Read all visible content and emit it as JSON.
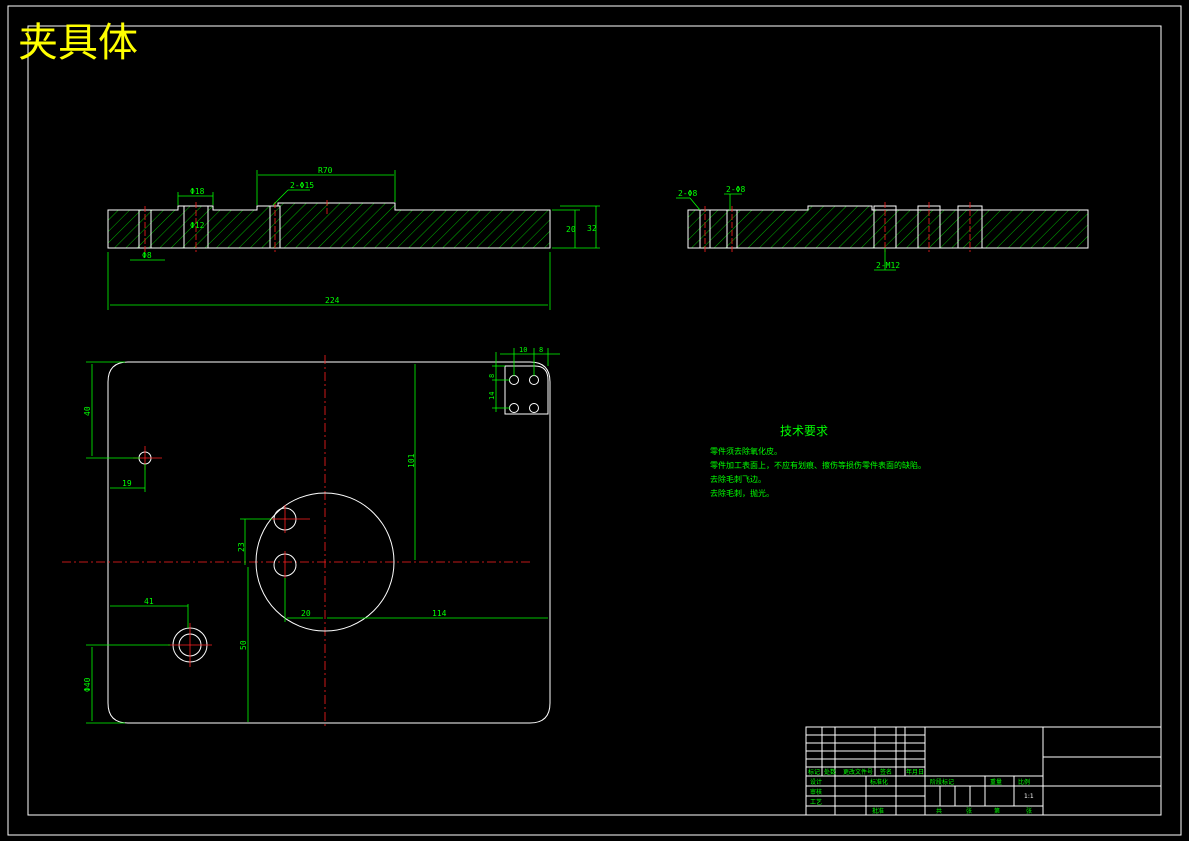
{
  "title": "夹具体",
  "colors": {
    "background": "#000000",
    "outline": "#ffffff",
    "dimension": "#00ff00",
    "centerline": "#ff2020",
    "title": "#ffff00"
  },
  "section_a_dims": {
    "width_total": "224",
    "top_step": "R70",
    "hole_callout": "2-Φ15",
    "slot_width": "Φ18",
    "small_hole": "Φ12",
    "bottom_offset": "Φ8",
    "height_inner": "20",
    "height_outer": "32"
  },
  "section_b_dims": {
    "left_callout": "2-Φ8",
    "mid_callout": "2-Φ8",
    "thread_callout": "2-M12"
  },
  "plan_dims": {
    "top_left_vertical": "40",
    "hole_offset_x": "19",
    "right_vertical": "101",
    "circle_spacing": "23",
    "left_vertical": "50",
    "circle_offset": "20",
    "right_horizontal": "114",
    "counterbore_x": "41",
    "counterbore_y": "Φ40",
    "detail_a": "10",
    "detail_b": "8",
    "detail_c": "8",
    "detail_d": "14"
  },
  "tech_notes": {
    "heading": "技术要求",
    "lines": [
      "零件须去除氧化皮。",
      "零件加工表面上，不应有划痕、擦伤等损伤零件表面的缺陷。",
      "去除毛刺飞边。",
      "去除毛刺，抛光。"
    ]
  },
  "title_block": {
    "row_labels": [
      "标记",
      "处数",
      "更改文件号",
      "签名",
      "年月日"
    ],
    "design_label": "设计",
    "standard_label": "标准化",
    "stage_labels": [
      "阶段标记",
      "重量",
      "比例"
    ],
    "scale_value": "1:1",
    "bottom_labels": [
      "共",
      "张",
      "第",
      "张"
    ],
    "review_label": "审核",
    "process_label": "工艺",
    "approve_label": "批准"
  }
}
